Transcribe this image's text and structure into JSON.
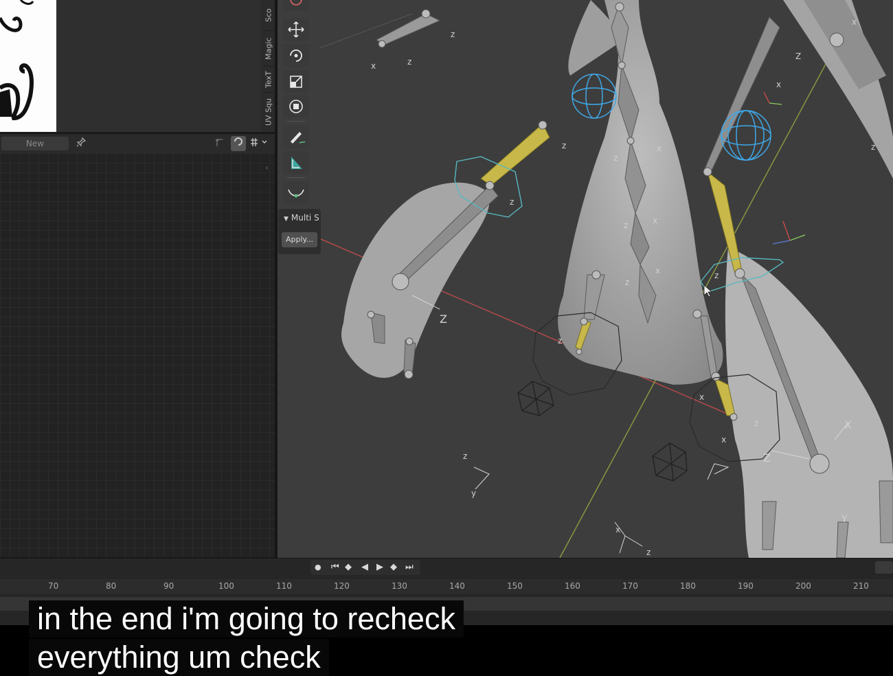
{
  "image_editor": {
    "new_button_label": "New",
    "pin_icon": "pin-icon"
  },
  "sidebar_tabs": [
    "Sco",
    "Magic",
    "TexT",
    "UV Squ"
  ],
  "toolbar": {
    "tools": [
      "cursor-icon",
      "move-icon",
      "rotate-icon",
      "scale-icon",
      "transform-icon",
      "annotate-icon",
      "measure-icon",
      "curve-icon"
    ]
  },
  "operator_panel": {
    "title": "Multi S",
    "apply_label": "Apply..."
  },
  "timeline": {
    "frame_labels": [
      "70",
      "80",
      "90",
      "100",
      "110",
      "120",
      "130",
      "140",
      "150",
      "160",
      "170",
      "180",
      "190",
      "200",
      "210"
    ]
  },
  "captions": {
    "line1": "in the end i'm going to recheck",
    "line2": "everything um check"
  },
  "colors": {
    "viewport_bg": "#3d3d3d",
    "selected_bone": "#c8b84a",
    "bone_shape_blue": "#3fa8e8",
    "x_axis_red": "#c84444",
    "y_axis_green": "#8a9a3a"
  }
}
